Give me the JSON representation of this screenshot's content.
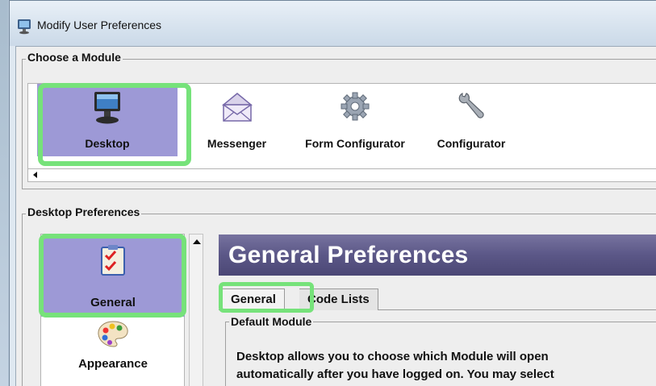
{
  "window": {
    "title": "Modify User Preferences"
  },
  "module_group": {
    "legend": "Choose a Module",
    "modules": [
      {
        "label": "Desktop",
        "icon": "monitor-icon",
        "selected": true
      },
      {
        "label": "Messenger",
        "icon": "envelope-icon",
        "selected": false
      },
      {
        "label": "Form Configurator",
        "icon": "gear-icon",
        "selected": false
      },
      {
        "label": "Configurator",
        "icon": "wrench-icon",
        "selected": false
      }
    ]
  },
  "desktop_prefs": {
    "legend": "Desktop Preferences",
    "nav_items": [
      {
        "label": "General",
        "icon": "checklist-icon",
        "selected": true
      },
      {
        "label": "Appearance",
        "icon": "palette-icon",
        "selected": false
      }
    ],
    "banner_title": "General Preferences",
    "tabs": [
      {
        "label": "General",
        "active": true
      },
      {
        "label": "Code Lists",
        "active": false
      }
    ],
    "default_module": {
      "legend": "Default Module",
      "description_line1": "Desktop allows you to choose which Module will open",
      "description_line2": "automatically after you have logged on.  You may select"
    }
  },
  "colors": {
    "selection": "#9d99d6",
    "highlight": "#76e27a",
    "banner": "#5b5787"
  }
}
